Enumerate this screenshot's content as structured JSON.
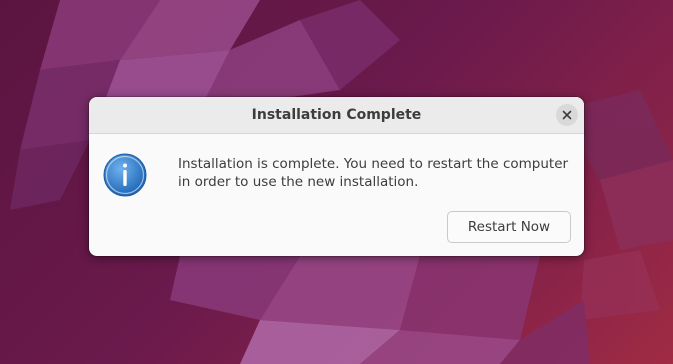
{
  "dialog": {
    "title": "Installation Complete",
    "message": "Installation is complete. You need to restart the computer\nin order to use the new installation.",
    "restart_label": "Restart Now",
    "close_icon": "close-icon",
    "info_icon": "info-icon"
  },
  "colors": {
    "wallpaper": "#6a1a4c",
    "dialog_bg": "#fafafa",
    "titlebar_bg": "#ebebeb",
    "info_blue": "#2a78c9"
  }
}
